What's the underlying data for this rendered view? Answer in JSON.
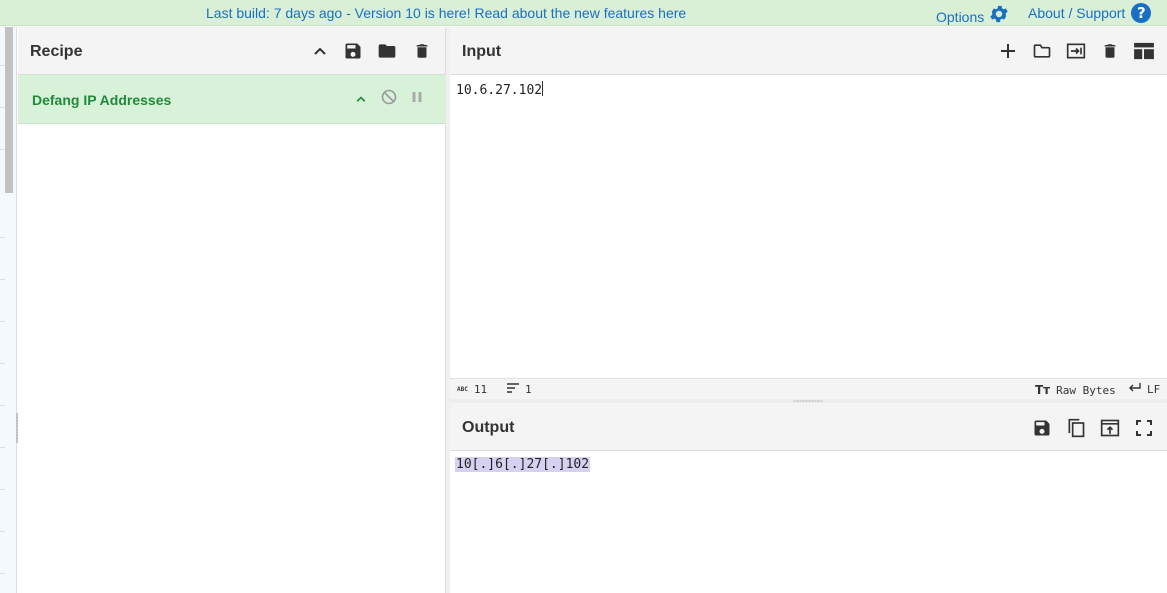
{
  "banner": {
    "message": "Last build: 7 days ago - Version 10 is here! Read about the new features here",
    "options_label": "Options",
    "about_label": "About / Support",
    "help_glyph": "?",
    "link_color": "#1a6fc4",
    "background": "#d9f0d6"
  },
  "recipe": {
    "title": "Recipe",
    "header_icons": [
      "chevron-up-icon",
      "save-icon",
      "folder-icon",
      "trash-icon"
    ],
    "operations": [
      {
        "name": "Defang IP Addresses",
        "icons": [
          "chevron-up-icon",
          "disable-icon",
          "pause-icon"
        ],
        "color": "#1f8a3a",
        "background": "#d8f2da"
      }
    ]
  },
  "input": {
    "title": "Input",
    "value": "10.6.27.102",
    "header_icons": [
      "plus-icon",
      "folder-icon",
      "load-icon",
      "trash-icon",
      "layout-icon"
    ],
    "status": {
      "length_label": "ABC",
      "length": "11",
      "lines": "1",
      "encoding": "Raw Bytes",
      "eol": "LF"
    }
  },
  "output": {
    "title": "Output",
    "value": "10[.]6[.]27[.]102",
    "highlight": "#d7d1f1",
    "header_icons": [
      "save-icon",
      "copy-icon",
      "replace-input-icon",
      "fullscreen-icon"
    ]
  }
}
